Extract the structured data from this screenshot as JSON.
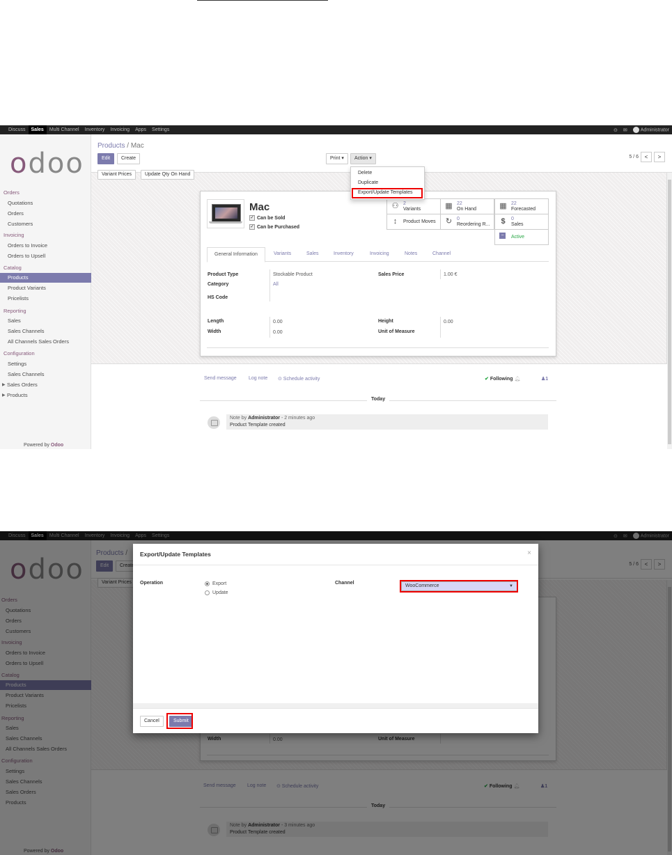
{
  "top_menu": [
    "Discuss",
    "Sales",
    "Multi Channel",
    "Inventory",
    "Invoicing",
    "Apps",
    "Settings"
  ],
  "active_menu": "Sales",
  "user": "Administrator",
  "sidebar": {
    "sections": [
      {
        "title": "Orders",
        "items": [
          "Quotations",
          "Orders",
          "Customers"
        ]
      },
      {
        "title": "Invoicing",
        "items": [
          "Orders to Invoice",
          "Orders to Upsell"
        ]
      },
      {
        "title": "Catalog",
        "items": [
          "Products",
          "Product Variants",
          "Pricelists"
        ]
      },
      {
        "title": "Reporting",
        "items": [
          "Sales",
          "Sales Channels",
          "All Channels Sales Orders"
        ]
      },
      {
        "title": "Configuration",
        "items": [
          "Settings",
          "Sales Channels"
        ]
      }
    ],
    "collapsed": [
      "Sales Orders",
      "Products"
    ],
    "active_item": "Products",
    "powered_by": "Powered by",
    "powered_brand": "Odoo"
  },
  "logo": "odoo",
  "breadcrumb": {
    "parent": "Products",
    "separator": "/",
    "current": "Mac"
  },
  "buttons": {
    "edit": "Edit",
    "create": "Create",
    "print": "Print ▾",
    "action": "Action ▾",
    "variant_prices": "Variant Prices",
    "update_qty": "Update Qty On Hand"
  },
  "pager": {
    "value": "5 / 6",
    "prev": "<",
    "next": ">"
  },
  "action_menu": [
    "Delete",
    "Duplicate",
    "Export/Update Templates"
  ],
  "product": {
    "name": "Mac",
    "can_be_sold": "Can be Sold",
    "can_be_purchased": "Can be Purchased",
    "stats": {
      "variants_n": "2",
      "variants_l": "Variants",
      "onhand_n": "22",
      "onhand_l": "On Hand",
      "forecast_n": "22",
      "forecast_l": "Forecasted",
      "moves_l": "Product Moves",
      "reorder_n": "0",
      "reorder_l": "Reordering R...",
      "sales_n": "0",
      "sales_l": "Sales",
      "active_l": "Active"
    },
    "tabs": [
      "General Information",
      "Variants",
      "Sales",
      "Inventory",
      "Invoicing",
      "Notes",
      "Channel"
    ],
    "fields": {
      "product_type_l": "Product Type",
      "product_type_v": "Stockable Product",
      "category_l": "Category",
      "category_v": "All",
      "hs_code_l": "HS Code",
      "sales_price_l": "Sales Price",
      "sales_price_v": "1.00 €",
      "length_l": "Length",
      "length_v": "0.00",
      "width_l": "Width",
      "width_v": "0.00",
      "height_l": "Height",
      "height_v": "0.00",
      "uom_l": "Unit of Measure"
    }
  },
  "chatter": {
    "send_message": "Send message",
    "log_note": "Log note",
    "schedule": "⊙ Schedule activity",
    "following": "Following",
    "followers": "1",
    "today": "Today",
    "msg1_prefix": "Note by",
    "msg1_author": "Administrator",
    "msg1_time_a": "- 2 minutes ago",
    "msg1_time_b": "- 3 minutes ago",
    "msg1_body": "Product Template created"
  },
  "dialog": {
    "title": "Export/Update Templates",
    "close": "×",
    "operation_label": "Operation",
    "options": [
      "Export",
      "Update"
    ],
    "selected_option": "Export",
    "channel_label": "Channel",
    "channel_value": "WooCommerce",
    "cancel": "Cancel",
    "submit": "Submit"
  },
  "highlight_color": "#e00000",
  "accent_color": "#7c7bad"
}
